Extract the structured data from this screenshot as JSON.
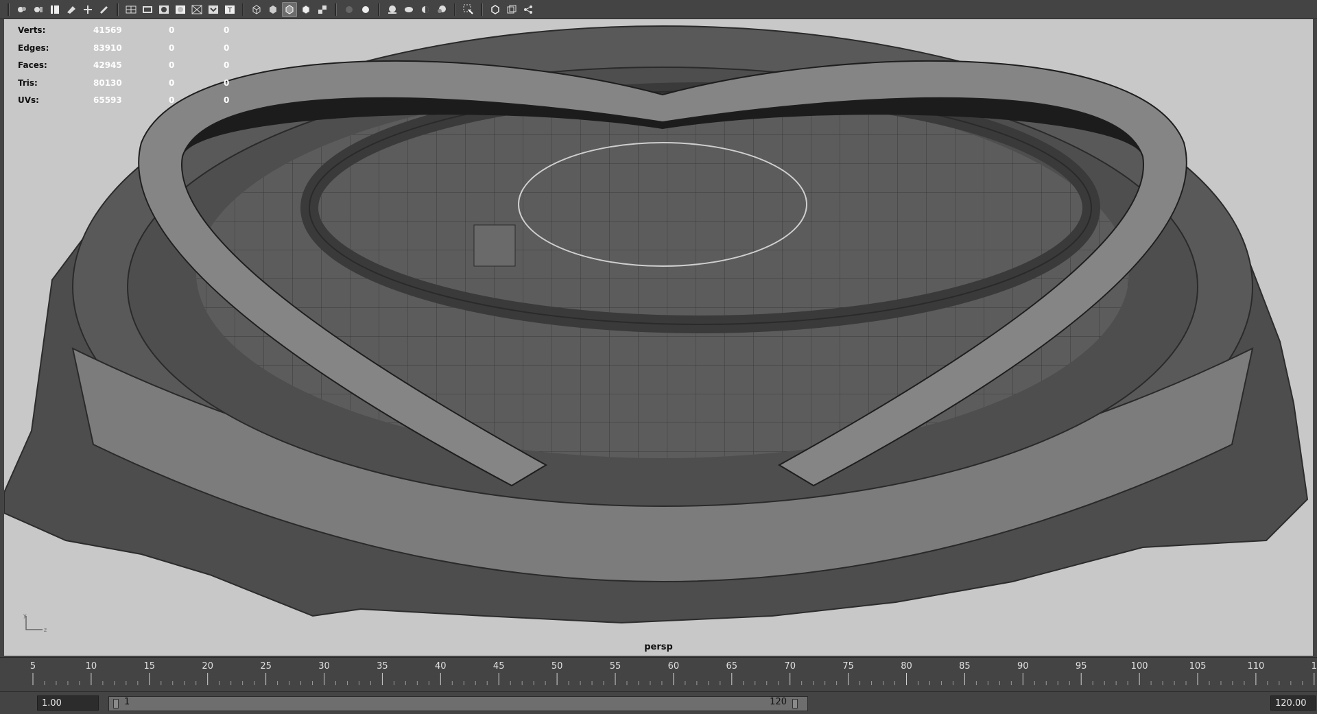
{
  "toolbar": {
    "icons": [
      "select-camera-icon",
      "camera-attributes-icon",
      "bookmark-icon",
      "image-plane-icon",
      "2d-pan-zoom-icon",
      "grease-pencil-icon",
      "grid-icon",
      "film-gate-icon",
      "resolution-gate-icon",
      "gate-mask-icon",
      "field-chart-icon",
      "safe-title-icon",
      "wireframe-icon",
      "smooth-shade-icon",
      "wireframe-on-shaded-icon",
      "xray-icon",
      "textured-icon",
      "use-all-lights-icon",
      "shadows-icon",
      "ambient-occlusion-icon",
      "motion-blur-icon",
      "anti-aliasing-icon",
      "isolate-select-icon",
      "xray-active-icon",
      "xray-joints-icon",
      "backface-culling-icon"
    ]
  },
  "hud": {
    "rows": [
      {
        "label": "Verts:",
        "v1": "41569",
        "v2": "0",
        "v3": "0"
      },
      {
        "label": "Edges:",
        "v1": "83910",
        "v2": "0",
        "v3": "0"
      },
      {
        "label": "Faces:",
        "v1": "42945",
        "v2": "0",
        "v3": "0"
      },
      {
        "label": "Tris:",
        "v1": "80130",
        "v2": "0",
        "v3": "0"
      },
      {
        "label": "UVs:",
        "v1": "65593",
        "v2": "0",
        "v3": "0"
      }
    ]
  },
  "viewport": {
    "camera_label": "persp"
  },
  "timeline": {
    "ticks": [
      "5",
      "10",
      "15",
      "20",
      "25",
      "30",
      "35",
      "40",
      "45",
      "50",
      "55",
      "60",
      "65",
      "70",
      "75",
      "80",
      "85",
      "90",
      "95",
      "100",
      "105",
      "110",
      "1"
    ]
  },
  "range": {
    "start_time": "1.00",
    "playback_start": "1",
    "playback_end": "120",
    "end_time": "120.00"
  }
}
